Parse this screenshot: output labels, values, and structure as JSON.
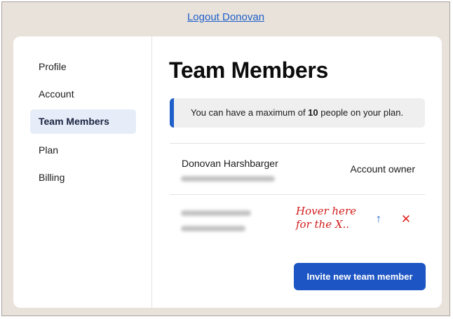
{
  "header": {
    "logout_label": "Logout Donovan"
  },
  "sidebar": {
    "items": [
      {
        "label": "Profile",
        "active": false
      },
      {
        "label": "Account",
        "active": false
      },
      {
        "label": "Team Members",
        "active": true
      },
      {
        "label": "Plan",
        "active": false
      },
      {
        "label": "Billing",
        "active": false
      }
    ]
  },
  "main": {
    "title": "Team Members",
    "notice": {
      "prefix": "You can have a maximum of ",
      "count": "10",
      "suffix": " people on your plan."
    },
    "members": [
      {
        "name": "Donovan Harshbarger",
        "email_blurred": true,
        "role": "Account owner"
      },
      {
        "name_blurred": true,
        "email_blurred": true
      }
    ],
    "annotation": "Hover here for the X..",
    "invite_label": "Invite new team member"
  },
  "icons": {
    "move_up": "arrow-up-icon",
    "remove": "close-icon"
  },
  "colors": {
    "accent": "#1f5fc9",
    "danger": "#e02525",
    "annotation": "#d21c1c",
    "background": "#e8e2db"
  }
}
